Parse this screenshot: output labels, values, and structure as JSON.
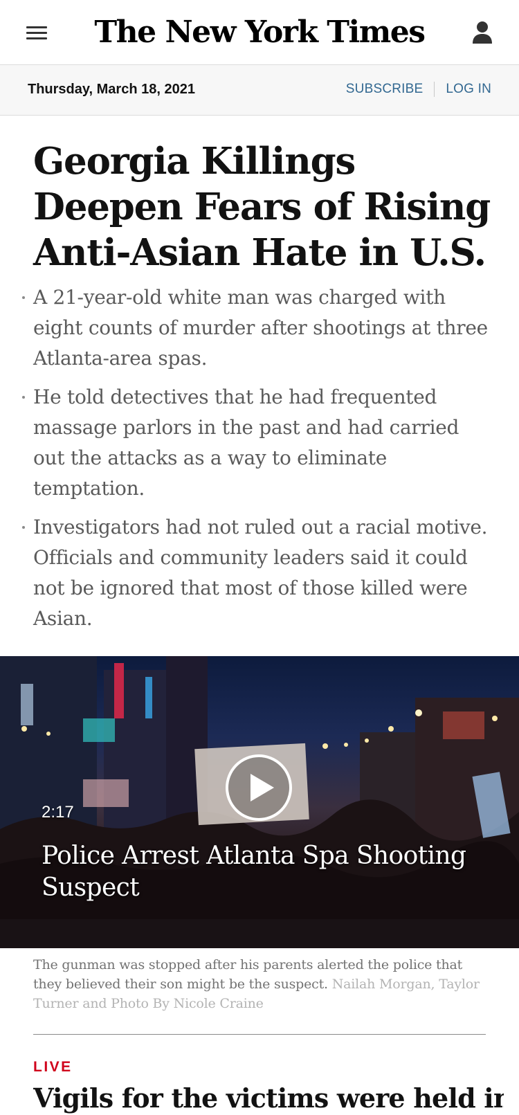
{
  "header": {
    "logo_text": "The New York Times",
    "menu_icon": "hamburger-menu-icon",
    "account_icon": "user-account-icon"
  },
  "datebar": {
    "date": "Thursday, March 18, 2021",
    "subscribe_label": "SUBSCRIBE",
    "login_label": "LOG IN",
    "link_color": "#326891"
  },
  "article": {
    "headline": "Georgia Killings Deepen Fears of Rising Anti-Asian Hate in U.S.",
    "summary": [
      "A 21-year-old white man was charged with eight counts of murder after shootings at three Atlanta-area spas.",
      "He told detectives that he had frequented massage parlors in the past and had carried out the attacks as a way to eliminate temptation.",
      "Investigators had not ruled out a racial motive. Officials and community leaders said it could not be ignored that most of those killed were Asian."
    ]
  },
  "video": {
    "duration": "2:17",
    "title": "Police Arrest Atlanta Spa Shooting Suspect",
    "play_icon": "play-icon",
    "caption": "The gunman was stopped after his parents alerted the police that they believed their son might be the suspect.",
    "credit": "Nailah Morgan, Taylor Turner and Photo By Nicole Craine"
  },
  "next_story": {
    "label": "LIVE",
    "label_color": "#d0021b",
    "headline": "Vigils for the victims were held in"
  }
}
